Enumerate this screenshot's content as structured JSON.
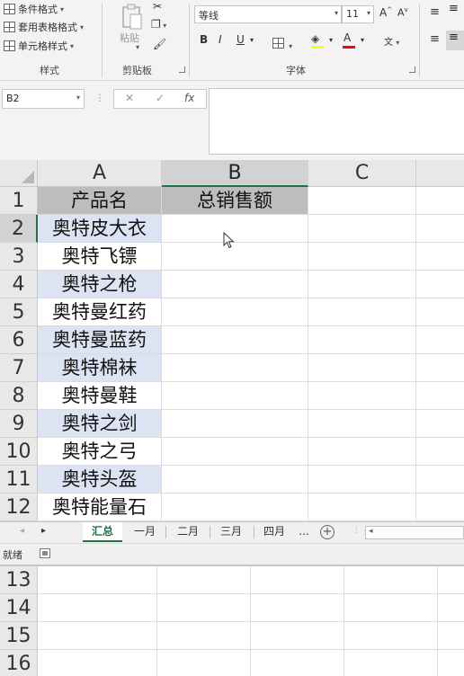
{
  "ribbon": {
    "styles": {
      "conditional_formatting": "条件格式",
      "format_as_table": "套用表格格式",
      "cell_styles": "单元格样式",
      "group_label": "样式"
    },
    "clipboard": {
      "paste_label": "粘贴",
      "group_label": "剪贴板"
    },
    "font": {
      "font_name": "等线",
      "font_size": "11",
      "bold": "B",
      "italic": "I",
      "underline": "U",
      "font_color_letter": "A",
      "wen": "文",
      "group_label": "字体"
    }
  },
  "formula_bar": {
    "name_box": "B2",
    "cancel": "✕",
    "enter": "✓",
    "fx": "fx",
    "formula": ""
  },
  "sheet": {
    "columns": [
      "A",
      "B",
      "C"
    ],
    "rows": [
      "1",
      "2",
      "3",
      "4",
      "5",
      "6",
      "7",
      "8",
      "9",
      "10",
      "11",
      "12"
    ],
    "header_row": [
      "产品名",
      "总销售额"
    ],
    "products": [
      "奥特皮大衣",
      "奥特飞镖",
      "奥特之枪",
      "奥特曼红药",
      "奥特曼蓝药",
      "奥特棉袜",
      "奥特曼鞋",
      "奥特之剑",
      "奥特之弓",
      "奥特头盔",
      "奥特能量石"
    ],
    "selected_cell": "B2"
  },
  "tabs": {
    "items": [
      "汇总",
      "一月",
      "二月",
      "三月",
      "四月"
    ],
    "more": "...",
    "active": "汇总",
    "add": "+"
  },
  "status": {
    "ready": "就绪"
  },
  "lower_sheet": {
    "rows": [
      "13",
      "14",
      "15",
      "16"
    ]
  }
}
